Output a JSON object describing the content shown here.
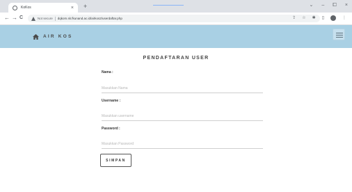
{
  "browser": {
    "tab_title": "KoKos",
    "tab_close": "×",
    "new_tab": "+",
    "window_controls": [
      "⌄",
      "–",
      "⧠",
      "×"
    ],
    "nav": {
      "back": "←",
      "forward": "→",
      "reload": "C"
    },
    "security_label": "Not secure",
    "url": "dqkom.sk.fkunand.ac.id/airkos2/userdaftar.php",
    "toolbar_icons": [
      "share-icon",
      "star-icon",
      "extensions-icon",
      "sidebar-icon",
      "profile-avatar-icon",
      "menu-icon"
    ],
    "toolbar_glyphs": [
      "⇪",
      "☆",
      "✱",
      "▯",
      "⋮"
    ]
  },
  "header": {
    "brand": "AIR KOS",
    "home_icon": "home-icon",
    "menu_icon": "hamburger-menu-icon"
  },
  "form": {
    "title": "PENDAFTARAN USER",
    "fields": [
      {
        "label": "Nama :",
        "placeholder": "Masukkan Nama",
        "value": ""
      },
      {
        "label": "Username :",
        "placeholder": "Masukkan username",
        "value": ""
      },
      {
        "label": "Password :",
        "placeholder": "Masukkan Password",
        "value": ""
      }
    ],
    "submit_label": "SIMPAN"
  },
  "colors": {
    "navbar_bg": "#a9d0e4",
    "page_bg": "#ffffff",
    "chrome_bg": "#dee1e6"
  }
}
